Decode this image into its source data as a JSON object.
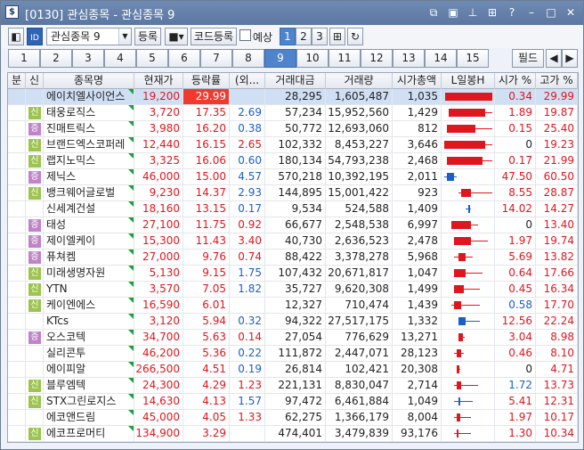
{
  "window": {
    "title": "[0130] 관심종목 - 관심종목 9",
    "icon_label": "$"
  },
  "toolbar": {
    "group_select": "관심종목 9",
    "register_label": "등록",
    "code_register_label": "코드등록",
    "preview_label": "예상",
    "page_buttons": [
      "1",
      "2",
      "3"
    ]
  },
  "tabs": [
    "1",
    "2",
    "3",
    "4",
    "5",
    "6",
    "7",
    "8",
    "9",
    "10",
    "11",
    "12",
    "13",
    "14",
    "15"
  ],
  "active_tab": "9",
  "field_button": "필드",
  "columns": [
    "분",
    "신",
    "종목명",
    "현재가",
    "등락률",
    "(외...",
    "거래대금",
    "거래량",
    "시가총액",
    "L일봉H",
    "시가 %",
    "고가 %"
  ],
  "rows": [
    {
      "badge": "",
      "name": "에이치엘사이언스",
      "price": "19,200",
      "rate": "29.99",
      "foreign": "",
      "amount": "28,295",
      "volume": "1,605,487",
      "cap": "1,035",
      "open": "0.34",
      "high": "29.99",
      "open_color": "red",
      "foreign_color": "blue",
      "rate_hl": true,
      "candle": {
        "dir": "up",
        "body_from": 0.02,
        "body_to": 1.0,
        "wick_from": 0.02,
        "wick_to": 1.0
      }
    },
    {
      "badge": "신",
      "name": "태웅로직스",
      "price": "3,720",
      "rate": "17.35",
      "foreign": "2.69",
      "amount": "57,234",
      "volume": "15,952,560",
      "cap": "1,429",
      "open": "1.89",
      "high": "19.87",
      "open_color": "red",
      "foreign_color": "blue",
      "candle": {
        "dir": "up",
        "body_from": 0.1,
        "body_to": 0.85,
        "wick_from": 0.1,
        "wick_to": 1.0
      }
    },
    {
      "badge": "증",
      "name": "진매트릭스",
      "price": "3,980",
      "rate": "16.20",
      "foreign": "0.38",
      "amount": "50,772",
      "volume": "12,693,060",
      "cap": "812",
      "open": "0.15",
      "high": "25.40",
      "open_color": "red",
      "foreign_color": "blue",
      "candle": {
        "dir": "up",
        "body_from": 0.05,
        "body_to": 0.65,
        "wick_from": 0.05,
        "wick_to": 1.0
      }
    },
    {
      "badge": "신",
      "name": "브랜드엑스코퍼레",
      "price": "12,440",
      "rate": "16.15",
      "foreign": "2.65",
      "amount": "102,332",
      "volume": "8,453,227",
      "cap": "3,646",
      "open": "0",
      "high": "19.23",
      "open_color": "black",
      "foreign_color": "red",
      "candle": {
        "dir": "up",
        "body_from": 0.0,
        "body_to": 0.85,
        "wick_from": 0.0,
        "wick_to": 1.0
      }
    },
    {
      "badge": "신",
      "name": "랩지노믹스",
      "price": "3,325",
      "rate": "16.06",
      "foreign": "0.60",
      "amount": "180,134",
      "volume": "54,793,238",
      "cap": "2,468",
      "open": "0.17",
      "high": "21.99",
      "open_color": "red",
      "foreign_color": "blue",
      "candle": {
        "dir": "up",
        "body_from": 0.05,
        "body_to": 0.8,
        "wick_from": 0.05,
        "wick_to": 1.0
      }
    },
    {
      "badge": "증",
      "name": "제닉스",
      "price": "46,000",
      "rate": "15.00",
      "foreign": "4.57",
      "amount": "570,218",
      "volume": "10,392,195",
      "cap": "2,011",
      "open": "47.50",
      "high": "60.50",
      "open_color": "red",
      "foreign_color": "blue",
      "candle": {
        "dir": "down",
        "body_from": 0.05,
        "body_to": 0.2,
        "wick_from": 0.0,
        "wick_to": 0.25
      }
    },
    {
      "badge": "신",
      "name": "뱅크웨어글로벌",
      "price": "9,230",
      "rate": "14.37",
      "foreign": "2.93",
      "amount": "144,895",
      "volume": "15,001,422",
      "cap": "923",
      "open": "8.55",
      "high": "28.87",
      "open_color": "red",
      "foreign_color": "blue",
      "candle": {
        "dir": "up",
        "body_from": 0.35,
        "body_to": 0.55,
        "wick_from": 0.3,
        "wick_to": 1.0
      }
    },
    {
      "badge": "",
      "name": "신세계건설",
      "price": "18,160",
      "rate": "13.15",
      "foreign": "0.17",
      "amount": "9,534",
      "volume": "524,588",
      "cap": "1,409",
      "open": "14.02",
      "high": "14.27",
      "open_color": "red",
      "foreign_color": "blue",
      "candle": {
        "dir": "down",
        "body_from": 0.5,
        "body_to": 0.53,
        "wick_from": 0.45,
        "wick_to": 0.55
      }
    },
    {
      "badge": "증",
      "name": "태성",
      "price": "27,100",
      "rate": "11.75",
      "foreign": "0.92",
      "amount": "66,677",
      "volume": "2,548,538",
      "cap": "6,997",
      "open": "0",
      "high": "13.40",
      "open_color": "black",
      "foreign_color": "red",
      "candle": {
        "dir": "up",
        "body_from": 0.15,
        "body_to": 0.55,
        "wick_from": 0.15,
        "wick_to": 0.7
      }
    },
    {
      "badge": "증",
      "name": "제이엘케이",
      "price": "15,300",
      "rate": "11.43",
      "foreign": "3.40",
      "amount": "40,730",
      "volume": "2,636,523",
      "cap": "2,478",
      "open": "1.97",
      "high": "19.74",
      "open_color": "red",
      "foreign_color": "red",
      "candle": {
        "dir": "up",
        "body_from": 0.2,
        "body_to": 0.55,
        "wick_from": 0.2,
        "wick_to": 0.9
      }
    },
    {
      "badge": "증",
      "name": "퓨쳐켐",
      "price": "27,000",
      "rate": "9.76",
      "foreign": "0.74",
      "amount": "88,422",
      "volume": "3,378,278",
      "cap": "5,968",
      "open": "5.69",
      "high": "13.82",
      "open_color": "red",
      "foreign_color": "red",
      "candle": {
        "dir": "up",
        "body_from": 0.3,
        "body_to": 0.45,
        "wick_from": 0.2,
        "wick_to": 0.6
      }
    },
    {
      "badge": "신",
      "name": "미래생명자원",
      "price": "5,130",
      "rate": "9.15",
      "foreign": "1.75",
      "amount": "107,432",
      "volume": "20,671,817",
      "cap": "1,047",
      "open": "0.64",
      "high": "17.66",
      "open_color": "red",
      "foreign_color": "blue",
      "candle": {
        "dir": "up",
        "body_from": 0.2,
        "body_to": 0.45,
        "wick_from": 0.2,
        "wick_to": 0.8
      }
    },
    {
      "badge": "신",
      "name": "YTN",
      "price": "3,570",
      "rate": "7.05",
      "foreign": "1.82",
      "amount": "35,727",
      "volume": "9,620,308",
      "cap": "1,499",
      "open": "0.45",
      "high": "16.34",
      "open_color": "red",
      "foreign_color": "blue",
      "candle": {
        "dir": "up",
        "body_from": 0.2,
        "body_to": 0.4,
        "wick_from": 0.2,
        "wick_to": 0.75
      }
    },
    {
      "badge": "신",
      "name": "케이엔에스",
      "price": "16,590",
      "rate": "6.01",
      "foreign": "",
      "amount": "12,327",
      "volume": "710,474",
      "cap": "1,439",
      "open": "0.58",
      "high": "17.70",
      "open_color": "blue",
      "foreign_color": "blue",
      "candle": {
        "dir": "up",
        "body_from": 0.2,
        "body_to": 0.35,
        "wick_from": 0.15,
        "wick_to": 0.75
      }
    },
    {
      "badge": "",
      "name": "KTcs",
      "price": "3,120",
      "rate": "5.94",
      "foreign": "0.32",
      "amount": "94,322",
      "volume": "27,517,175",
      "cap": "1,332",
      "open": "12.56",
      "high": "22.24",
      "open_color": "red",
      "foreign_color": "blue",
      "candle": {
        "dir": "down",
        "body_from": 0.3,
        "body_to": 0.45,
        "wick_from": 0.3,
        "wick_to": 0.75
      }
    },
    {
      "badge": "증",
      "name": "오스코텍",
      "price": "34,700",
      "rate": "5.63",
      "foreign": "0.14",
      "amount": "27,054",
      "volume": "776,629",
      "cap": "13,271",
      "open": "3.04",
      "high": "8.98",
      "open_color": "red",
      "foreign_color": "red",
      "candle": {
        "dir": "up",
        "body_from": 0.3,
        "body_to": 0.38,
        "wick_from": 0.3,
        "wick_to": 0.42
      }
    },
    {
      "badge": "",
      "name": "실리콘투",
      "price": "46,200",
      "rate": "5.36",
      "foreign": "0.22",
      "amount": "111,872",
      "volume": "2,447,071",
      "cap": "28,123",
      "open": "0.46",
      "high": "8.10",
      "open_color": "red",
      "foreign_color": "blue",
      "candle": {
        "dir": "up",
        "body_from": 0.25,
        "body_to": 0.35,
        "wick_from": 0.2,
        "wick_to": 0.4
      }
    },
    {
      "badge": "",
      "name": "에이피알",
      "price": "266,500",
      "rate": "4.51",
      "foreign": "0.19",
      "amount": "26,814",
      "volume": "102,421",
      "cap": "20,308",
      "open": "0",
      "high": "4.71",
      "open_color": "black",
      "foreign_color": "blue",
      "candle": {
        "dir": "up",
        "body_from": 0.25,
        "body_to": 0.32,
        "wick_from": 0.25,
        "wick_to": 0.33
      }
    },
    {
      "badge": "신",
      "name": "블루엠텍",
      "price": "24,300",
      "rate": "4.29",
      "foreign": "1.23",
      "amount": "221,131",
      "volume": "8,830,047",
      "cap": "2,714",
      "open": "1.72",
      "high": "13.73",
      "open_color": "blue",
      "foreign_color": "red",
      "candle": {
        "dir": "up",
        "body_from": 0.25,
        "body_to": 0.35,
        "wick_from": 0.2,
        "wick_to": 0.7
      }
    },
    {
      "badge": "신",
      "name": "STX그린로지스",
      "price": "14,630",
      "rate": "4.13",
      "foreign": "1.57",
      "amount": "97,472",
      "volume": "6,461,884",
      "cap": "1,049",
      "open": "5.41",
      "high": "12.31",
      "open_color": "red",
      "foreign_color": "blue",
      "candle": {
        "dir": "down",
        "body_from": 0.3,
        "body_to": 0.32,
        "wick_from": 0.2,
        "wick_to": 0.6
      }
    },
    {
      "badge": "",
      "name": "에코앤드림",
      "price": "45,000",
      "rate": "4.05",
      "foreign": "1.33",
      "amount": "62,275",
      "volume": "1,366,179",
      "cap": "8,004",
      "open": "1.97",
      "high": "10.17",
      "open_color": "red",
      "foreign_color": "red",
      "candle": {
        "dir": "up",
        "body_from": 0.25,
        "body_to": 0.33,
        "wick_from": 0.2,
        "wick_to": 0.55
      }
    },
    {
      "badge": "신",
      "name": "에코프로머티",
      "price": "134,900",
      "rate": "3.29",
      "foreign": "",
      "amount": "474,401",
      "volume": "3,479,839",
      "cap": "93,176",
      "open": "1.30",
      "high": "10.34",
      "open_color": "red",
      "foreign_color": "blue",
      "candle": {
        "dir": "up",
        "body_from": 0.25,
        "body_to": 0.3,
        "wick_from": 0.2,
        "wick_to": 0.55
      }
    }
  ]
}
